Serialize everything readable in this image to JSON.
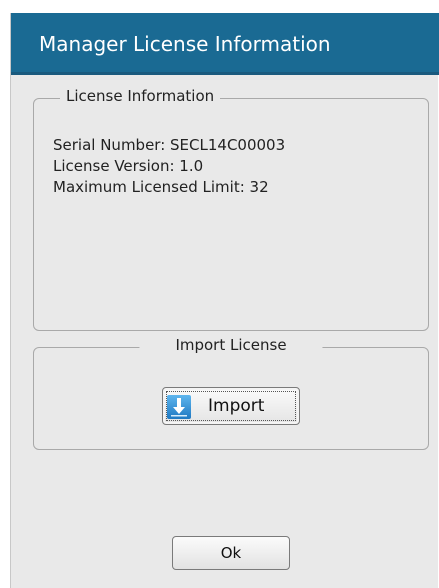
{
  "dialog": {
    "title": "Manager License Information",
    "title_bar_color": "#1a6a93"
  },
  "license_info": {
    "legend": "License Information",
    "serial_number": "Serial Number: SECL14C00003",
    "license_version": "License Version: 1.0",
    "max_limit": "Maximum Licensed Limit: 32"
  },
  "import_license": {
    "legend": "Import License",
    "button_label": "Import",
    "button_icon": "download-arrow-icon"
  },
  "footer": {
    "ok_label": "Ok"
  }
}
